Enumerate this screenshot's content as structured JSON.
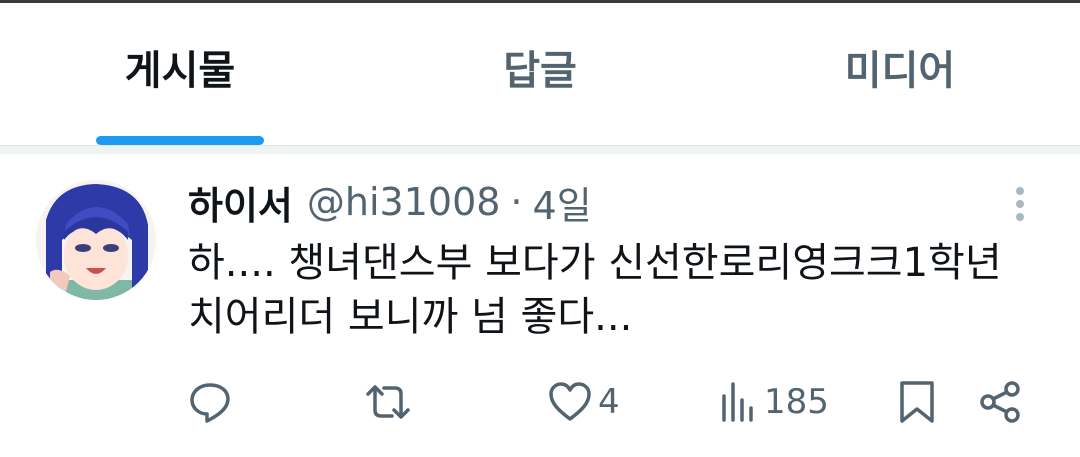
{
  "tabs": [
    {
      "label": "게시물",
      "active": true
    },
    {
      "label": "답글",
      "active": false
    },
    {
      "label": "미디어",
      "active": false
    }
  ],
  "colors": {
    "accent": "#1d9bf0",
    "text": "#0f1419",
    "secondary": "#536471"
  },
  "post": {
    "author_name": "하이서",
    "handle": "@hi31008",
    "separator": "·",
    "time": "4일",
    "text_lines": [
      "하.... 챙녀댄스부 보다가 신선한로리영크크1학년",
      "치어리더 보니까 넘 좋다..."
    ],
    "actions": {
      "reply_icon": "reply-icon",
      "repost_icon": "repost-icon",
      "like_icon": "heart-icon",
      "like_count": "4",
      "views_icon": "views-icon",
      "view_count": "185",
      "bookmark_icon": "bookmark-icon",
      "share_icon": "share-icon"
    }
  }
}
